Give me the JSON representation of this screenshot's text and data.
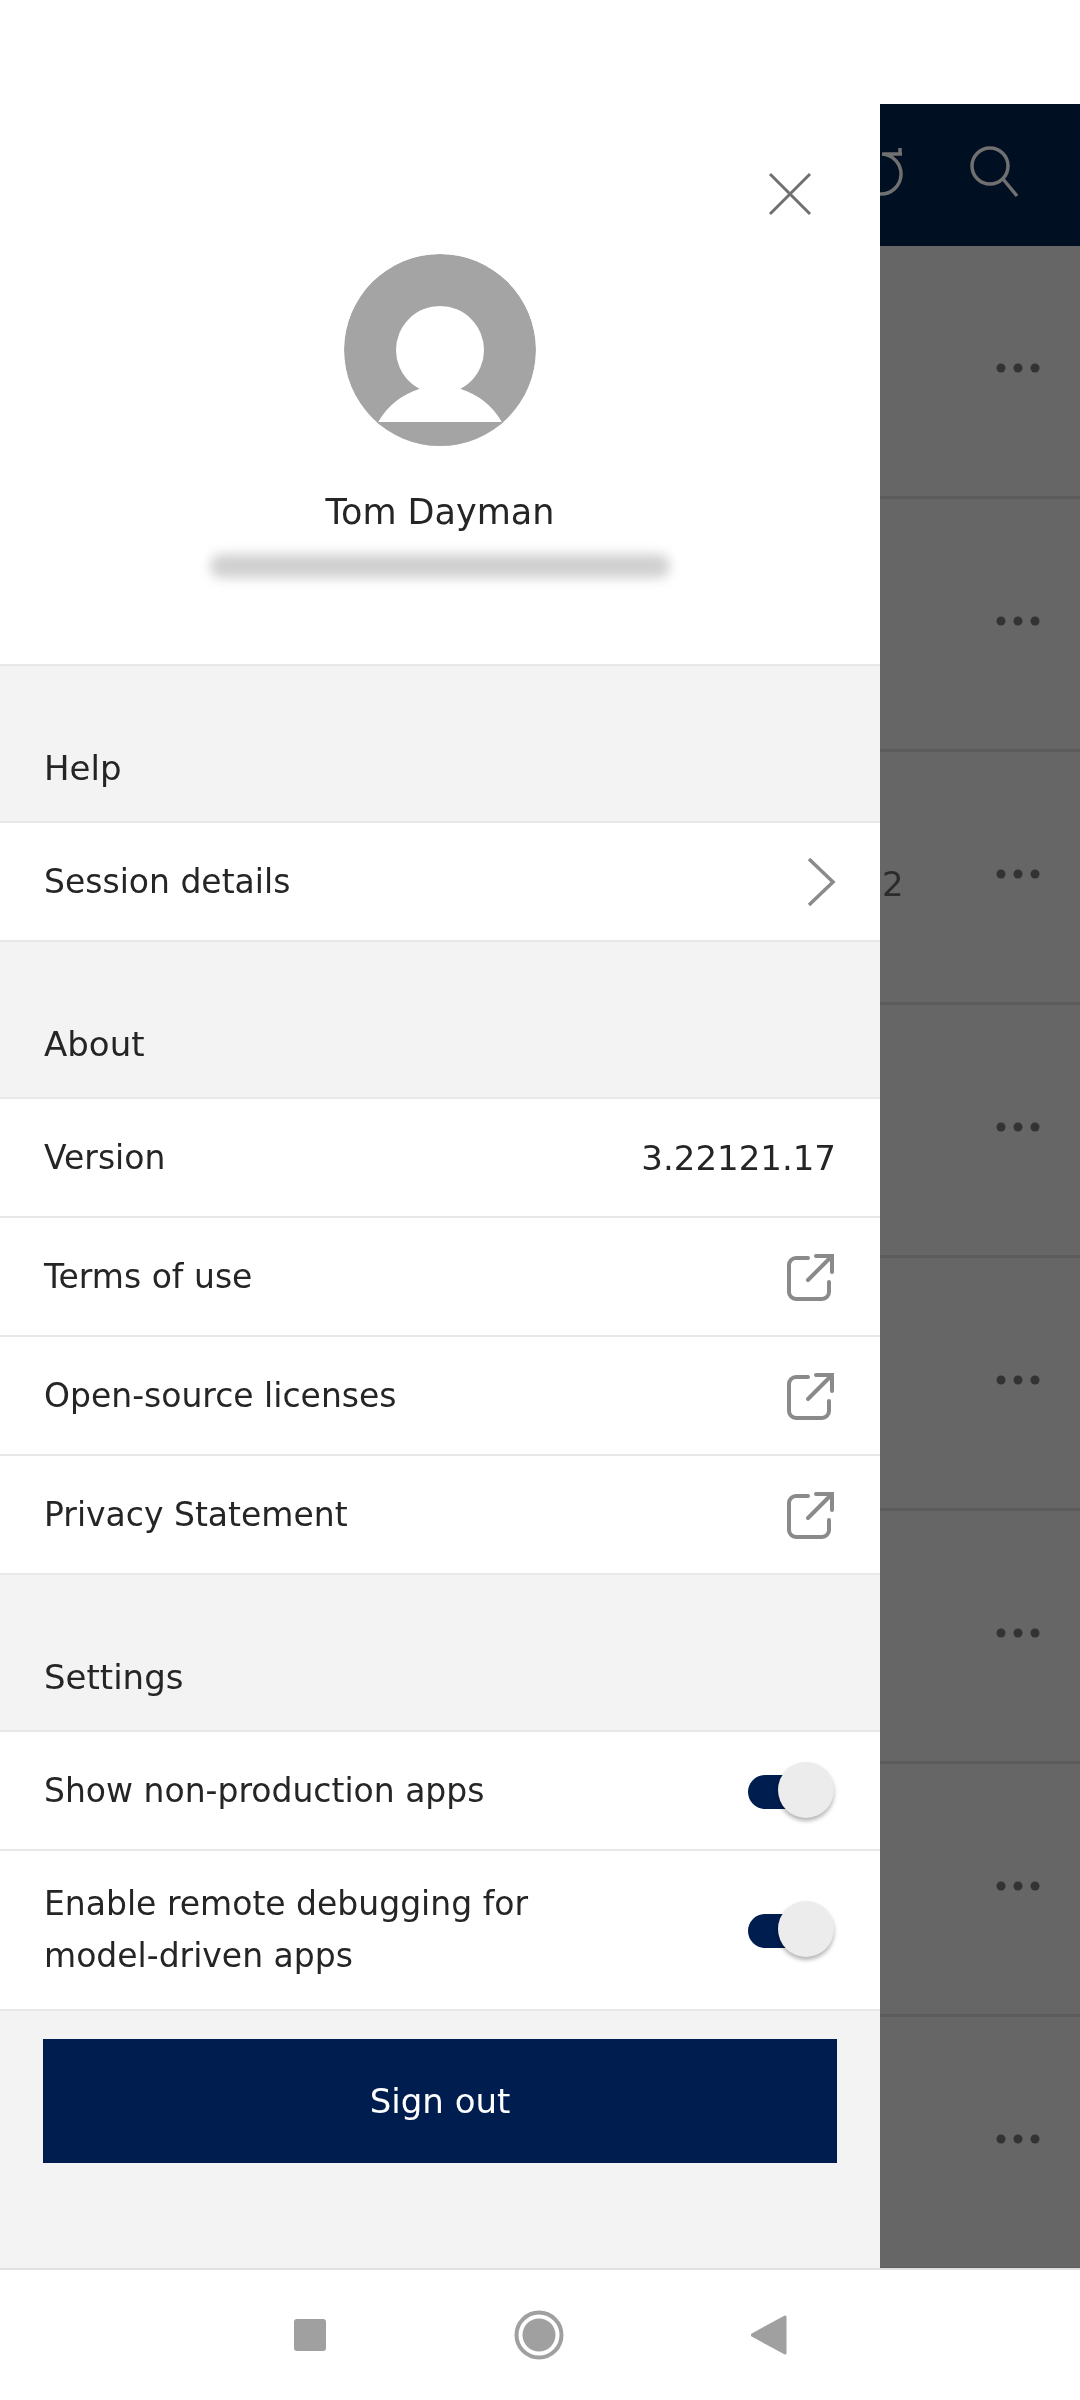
{
  "profile": {
    "name": "Tom Dayman",
    "email_redacted": true
  },
  "sections": [
    {
      "title": "Help",
      "items": [
        {
          "kind": "navigate",
          "label": "Session details"
        }
      ]
    },
    {
      "title": "About",
      "items": [
        {
          "kind": "value",
          "label": "Version",
          "value": "3.22121.17"
        },
        {
          "kind": "external",
          "label": "Terms of use"
        },
        {
          "kind": "external",
          "label": "Open-source licenses"
        },
        {
          "kind": "external",
          "label": "Privacy Statement"
        }
      ]
    },
    {
      "title": "Settings",
      "items": [
        {
          "kind": "toggle",
          "label": "Show non-production apps",
          "on": true
        },
        {
          "kind": "toggle",
          "label": "Enable remote debugging for model-driven apps",
          "on": true
        }
      ]
    }
  ],
  "sign_out": "Sign out",
  "background_rows": [
    {
      "more_menu": true
    },
    {
      "more_menu": true
    },
    {
      "more_menu": true,
      "partial_text": "2"
    },
    {
      "more_menu": true
    },
    {
      "more_menu": true
    },
    {
      "more_menu": true
    },
    {
      "more_menu": true
    },
    {
      "more_menu": true
    }
  ]
}
